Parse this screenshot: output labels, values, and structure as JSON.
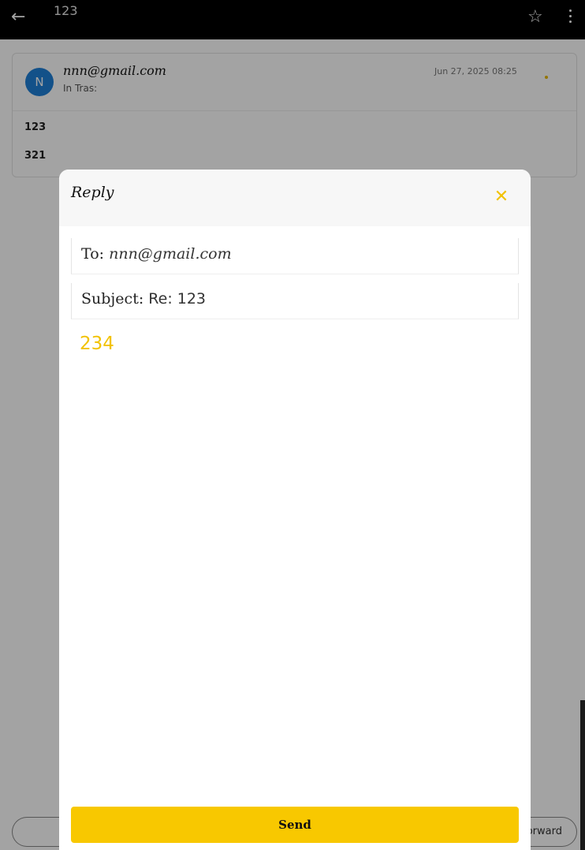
{
  "appbar": {
    "title": "123",
    "back_icon": "arrow-left-icon",
    "star_icon": "star-outline-icon",
    "more_icon": "more-vertical-icon"
  },
  "mail": {
    "avatar_letter": "N",
    "sender": "nnn@gmail.com",
    "folder": "In Tras:",
    "date": "Jun 27, 2025 08:25",
    "body_lines": [
      "123",
      "321"
    ]
  },
  "actions": {
    "right_button_label": "Forward"
  },
  "reply": {
    "title": "Reply",
    "to_label": "To:",
    "to_value": "nnn@gmail.com",
    "subject_label": "Subject:",
    "subject_value": "Re: 123",
    "body": "234",
    "send_label": "Send"
  },
  "colors": {
    "accent": "#f8c800",
    "avatar": "#1f7fd6",
    "appbar": "#000000"
  }
}
